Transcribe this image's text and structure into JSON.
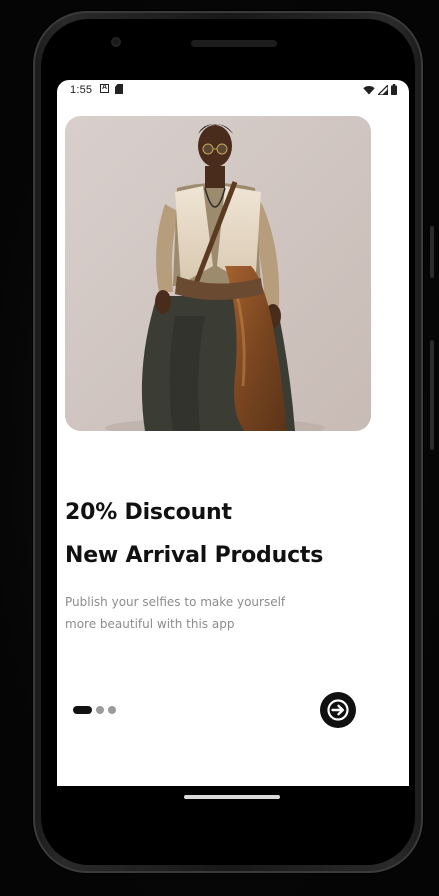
{
  "status_bar": {
    "time": "1:55",
    "left_icons": [
      "a-notification-icon",
      "sd-card-icon"
    ],
    "right_icons": [
      "wifi-icon",
      "signal-icon",
      "battery-icon"
    ]
  },
  "onboarding": {
    "headline_line1": "20%  Discount",
    "headline_line2": "New Arrival Products",
    "description_line1": "Publish your selfies to make yourself",
    "description_line2": "more beautiful with this app",
    "page_count": 3,
    "active_page": 1,
    "next_icon": "arrow-right-icon"
  },
  "colors": {
    "primary": "#111111",
    "muted_text": "#8c8c8c",
    "inactive_dot": "#9a9a9a",
    "background": "#ffffff"
  }
}
